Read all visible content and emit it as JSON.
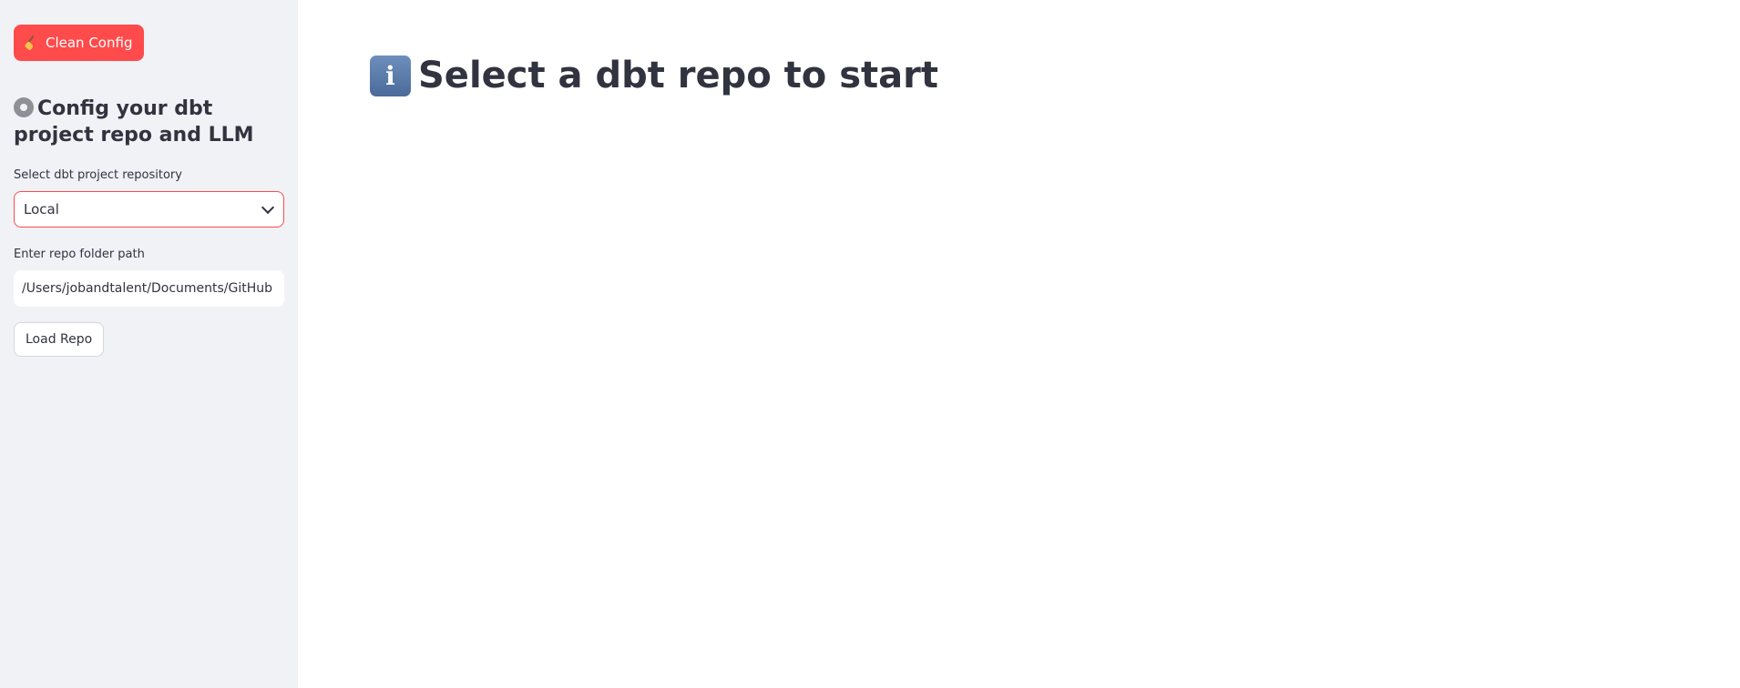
{
  "sidebar": {
    "clean_button_label": "Clean Config",
    "clean_button_icon": "broom-icon",
    "heading": "Config your dbt project repo and LLM",
    "heading_icon": "gear-icon",
    "repo_select": {
      "label": "Select dbt project repository",
      "value": "Local"
    },
    "repo_path": {
      "label": "Enter repo folder path",
      "value": "/Users/jobandtalent/Documents/GitHub"
    },
    "load_button_label": "Load Repo"
  },
  "main": {
    "title": "Select a dbt repo to start",
    "title_icon": "info-icon",
    "info_glyph": "i"
  },
  "colors": {
    "primary": "#ff4b4b",
    "sidebar_bg": "#f0f2f6",
    "text": "#31333f"
  }
}
